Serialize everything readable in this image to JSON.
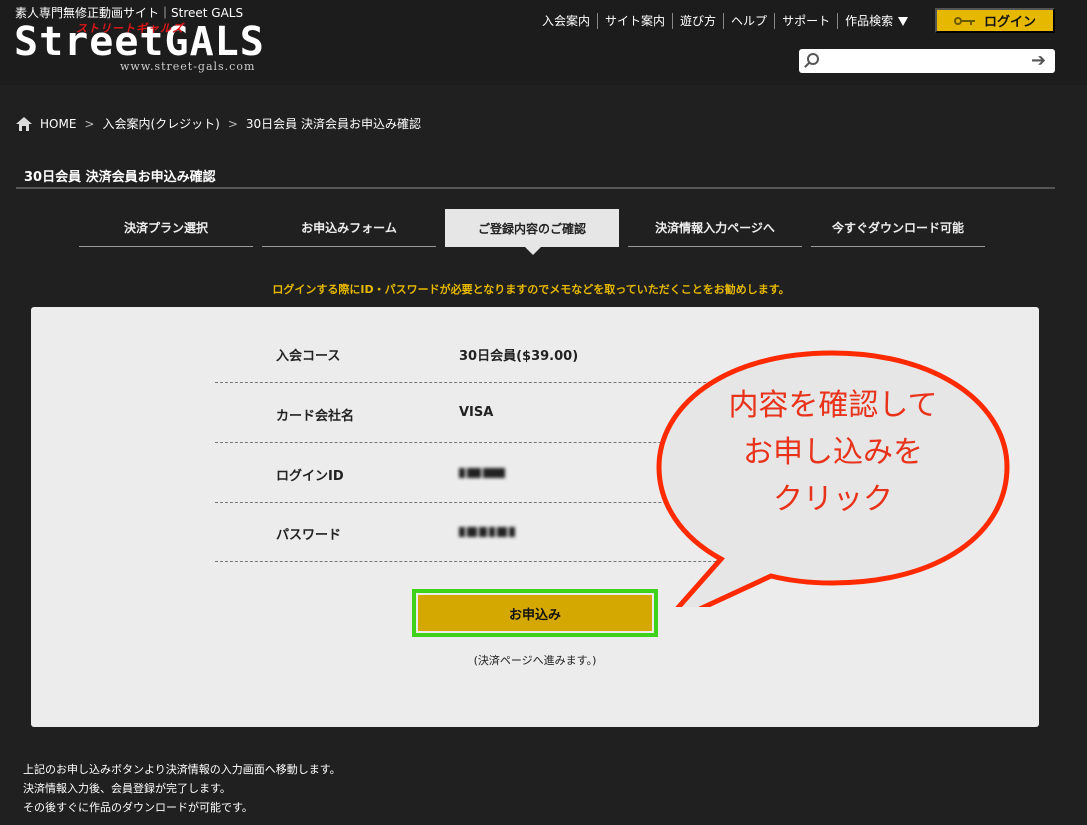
{
  "header": {
    "tagline": "素人専門無修正動画サイト｜Street GALS",
    "logo_text": "StreetGALS",
    "logo_kana": "ストリートギャルズ",
    "logo_url": "www.street-gals.com",
    "nav": [
      "入会案内",
      "サイト案内",
      "遊び方",
      "ヘルプ",
      "サポート"
    ],
    "nav_search_label": "作品検索",
    "login_label": "ログイン",
    "search_placeholder": "",
    "search_value": ""
  },
  "breadcrumb": {
    "items": [
      "HOME",
      "入会案内(クレジット)",
      "30日会員 決済会員お申込み確認"
    ]
  },
  "page_title": "30日会員 決済会員お申込み確認",
  "steps": [
    {
      "label": "決済プラン選択",
      "active": false
    },
    {
      "label": "お申込みフォーム",
      "active": false
    },
    {
      "label": "ご登録内容のご確認",
      "active": true
    },
    {
      "label": "決済情報入力ページへ",
      "active": false
    },
    {
      "label": "今すぐダウンロード可能",
      "active": false
    }
  ],
  "notice": "ログインする際にID・パスワードが必要となりますのでメモなどを取っていただくことをお勧めします。",
  "confirm": {
    "rows": [
      {
        "label": "入会コース",
        "value": "30日会員($39.00)"
      },
      {
        "label": "カード会社名",
        "value": "VISA"
      },
      {
        "label": "ログインID",
        "value": ""
      },
      {
        "label": "パスワード",
        "value": ""
      }
    ],
    "submit_label": "お申込み",
    "submit_note": "(決済ページへ進みます。)"
  },
  "callout": {
    "lines": [
      "内容を確認して",
      "お申し込みを",
      "クリック"
    ],
    "text_color": "#e8321a",
    "border_color": "#ff2a00",
    "fill_color": "#e6e6e6"
  },
  "footer": {
    "lines": [
      "上記のお申し込みボタンより決済情報の入力画面へ移動します。",
      "決済情報入力後、会員登録が完了します。",
      "その後すぐに作品のダウンロードが可能です。"
    ]
  },
  "colors": {
    "background": "#202020",
    "accent": "#e6b800",
    "highlight_border": "#3ed21a",
    "panel": "#ececec"
  }
}
